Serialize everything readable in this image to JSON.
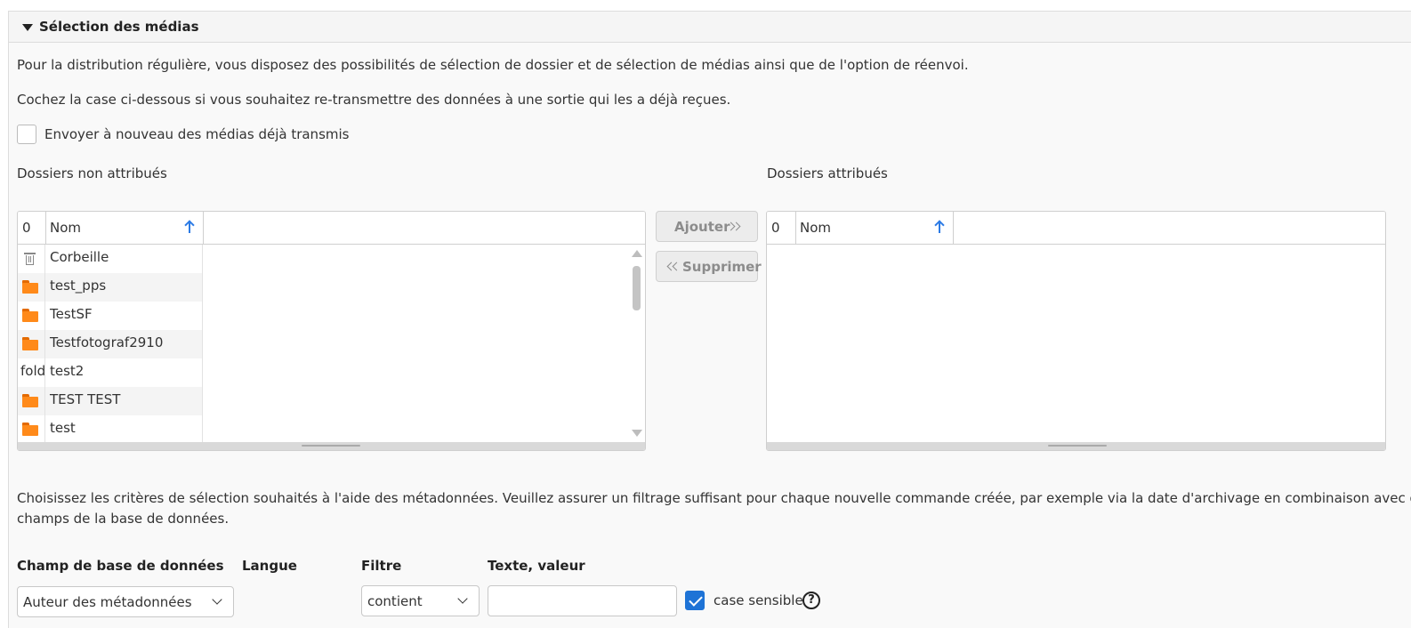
{
  "section": {
    "title": "Sélection des médias",
    "intro": "Pour la distribution régulière, vous disposez des possibilités de sélection de dossier et de sélection de médias ainsi que de l'option de réenvoi.",
    "resend_hint": "Cochez la case ci-dessous si vous souhaitez re-transmettre des données à une sortie qui les a déjà reçues.",
    "resend_checkbox": {
      "label": "Envoyer à nouveau des médias déjà transmis",
      "checked": false
    }
  },
  "unassigned": {
    "title": "Dossiers non attribués",
    "count": "0",
    "column": "Nom",
    "rows": [
      {
        "icon": "trash-icon",
        "name": "Corbeille"
      },
      {
        "icon": "folder-icon",
        "name": "test_pps"
      },
      {
        "icon": "folder-icon",
        "name": "TestSF"
      },
      {
        "icon": "folder-icon",
        "name": "Testfotograf2910"
      },
      {
        "icon": "text",
        "icon_text": "fold",
        "name": "test2"
      },
      {
        "icon": "folder-icon",
        "name": "TEST TEST"
      },
      {
        "icon": "folder-icon",
        "name": "test"
      }
    ]
  },
  "transfer": {
    "add_label": "Ajouter",
    "remove_label": "Supprimer"
  },
  "assigned": {
    "title": "Dossiers attribués",
    "count": "0",
    "column": "Nom",
    "rows": []
  },
  "criteria": {
    "text_line1": "Choisissez les critères de sélection souhaités à l'aide des métadonnées. Veuillez assurer un filtrage suffisant pour chaque nouvelle commande créée, par exemple via la date d'archivage en combinaison avec d'autres",
    "text_line2": "champs de la base de données.",
    "headers": {
      "field": "Champ de base de données",
      "language": "Langue",
      "filter": "Filtre",
      "value": "Texte, valeur"
    },
    "field_value": "Auteur des métadonnées",
    "filter_value": "contient",
    "text_value": "",
    "case_sensitive": {
      "label": "case sensible",
      "checked": true
    }
  },
  "colors": {
    "accent": "#1e73d6",
    "folder": "#ff8a1a",
    "sort_arrow": "#2c7be5"
  }
}
